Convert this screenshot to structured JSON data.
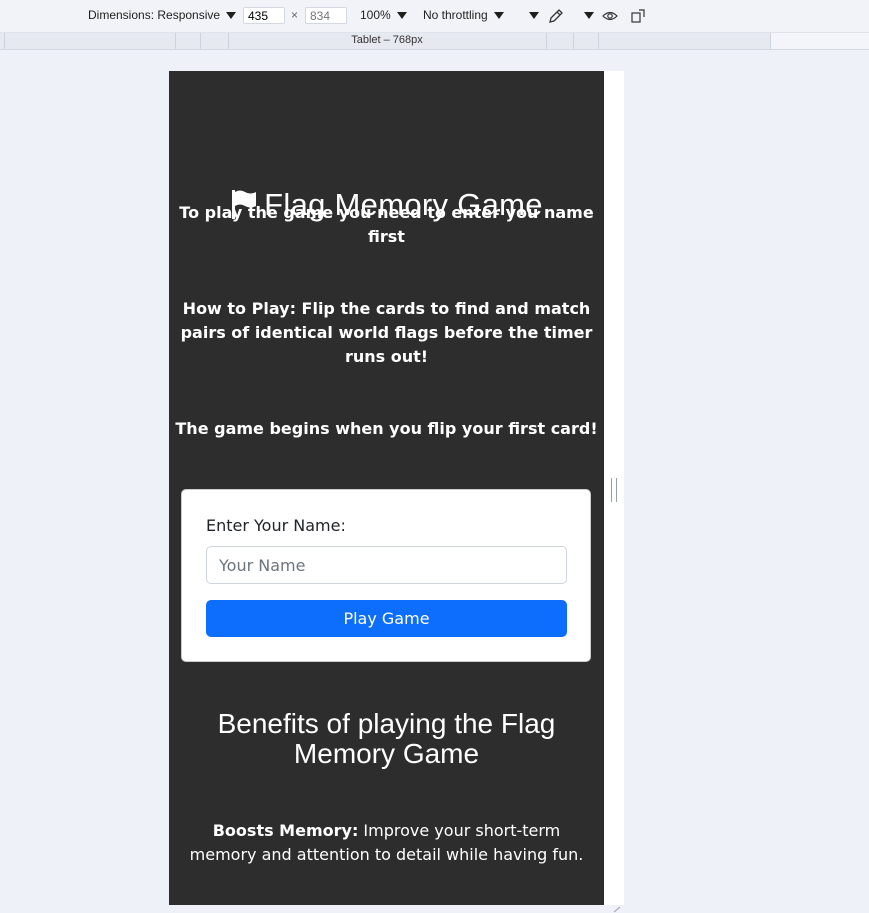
{
  "devtools": {
    "dimensions_label": "Dimensions: Responsive",
    "width_value": "435",
    "times": "×",
    "height_value": "834",
    "zoom": "100%",
    "throttling": "No throttling",
    "media_query_label": "Tablet – 768px"
  },
  "page": {
    "title": "Flag Memory Game",
    "intro": "To play the game you need to enter you name first",
    "how_to": "How to Play: Flip the cards to find and match pairs of identical world flags before the timer runs out!",
    "begin": "The game begins when you flip your first card!",
    "form": {
      "label": "Enter Your Name:",
      "placeholder": "Your Name",
      "button": "Play Game"
    },
    "benefits_title": "Benefits of playing the Flag Memory Game",
    "benefit_1_strong": "Boosts Memory:",
    "benefit_1_text": " Improve your short-term memory and attention to detail while having fun."
  },
  "colors": {
    "page_bg": "#2d2d2d",
    "button_bg": "#0d6efd",
    "devtools_bg": "#f1f3f9"
  },
  "icons": [
    "flag-icon",
    "eyedropper-icon",
    "eye-icon",
    "rotate-device-icon"
  ]
}
